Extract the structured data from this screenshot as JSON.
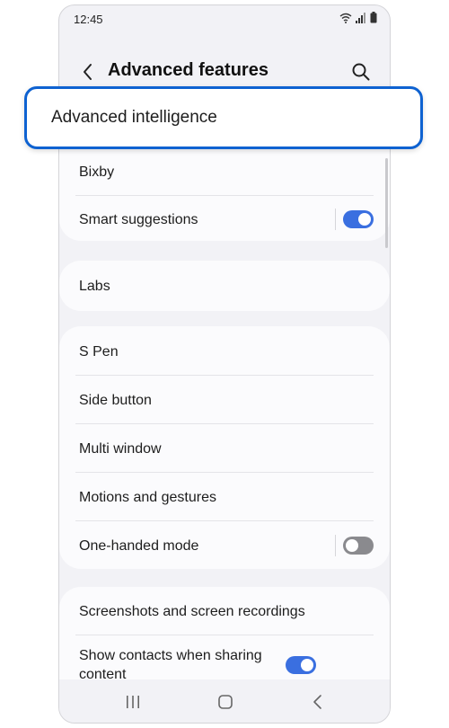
{
  "status_bar": {
    "time": "12:45"
  },
  "header": {
    "title": "Advanced features"
  },
  "highlight": {
    "label": "Advanced intelligence"
  },
  "sections": {
    "intelligence": {
      "bixby": "Bixby",
      "smart_suggestions": {
        "label": "Smart suggestions",
        "enabled": true
      }
    },
    "labs": {
      "label": "Labs"
    },
    "controls": {
      "s_pen": "S Pen",
      "side_button": "Side button",
      "multi_window": "Multi window",
      "motions": "Motions and gestures",
      "one_handed": {
        "label": "One-handed mode",
        "enabled": false
      }
    },
    "sharing": {
      "screenshots": "Screenshots and screen recordings",
      "show_contacts": {
        "label": "Show contacts when sharing content",
        "enabled": true
      }
    }
  },
  "colors": {
    "accent": "#3a6fe0",
    "highlight_border": "#0e62d1",
    "background": "#f2f2f6"
  }
}
